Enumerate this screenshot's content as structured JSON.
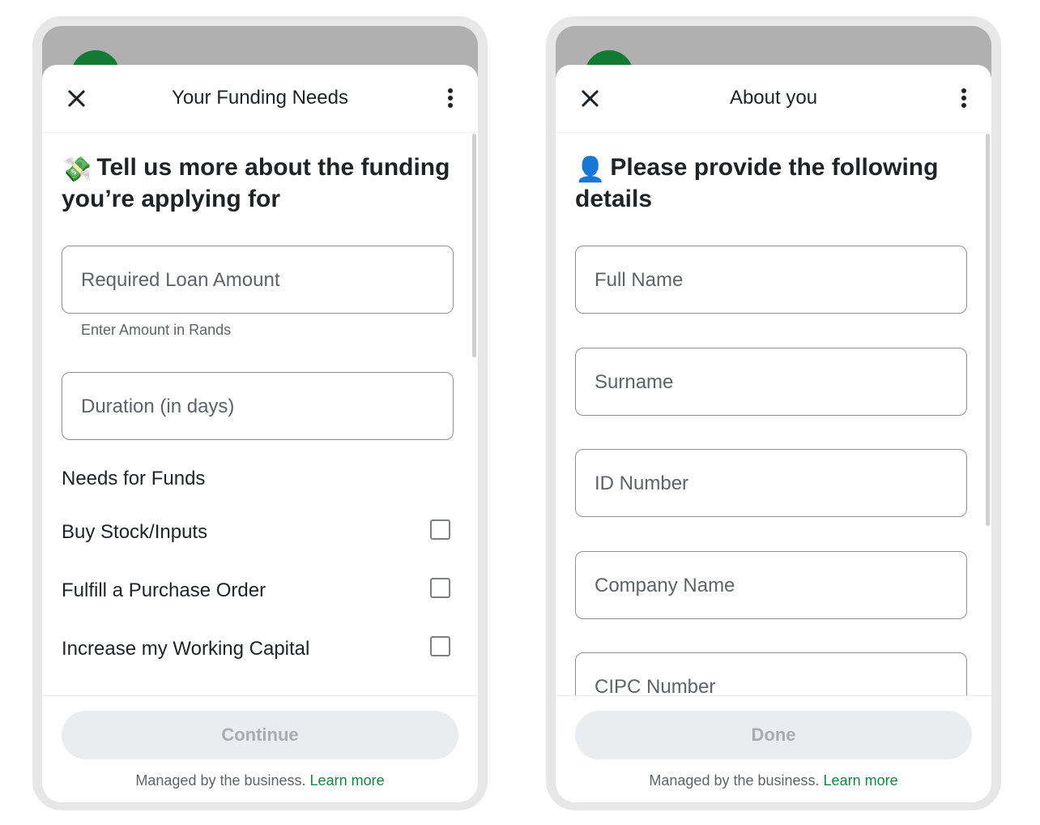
{
  "colors": {
    "accent_green": "#14853f",
    "avatar_green": "#127a33",
    "disabled_button_bg": "#e9edef",
    "disabled_button_text": "#a8adb2"
  },
  "screens": [
    {
      "title": "Your Funding Needs",
      "close_icon": "close-icon",
      "menu_icon": "more-vertical-icon",
      "heading_emoji": "💸",
      "heading": "Tell us more about the funding you’re applying for",
      "fields": [
        {
          "placeholder": "Required Loan Amount",
          "helper": "Enter Amount in Rands"
        },
        {
          "placeholder": "Duration (in days)"
        }
      ],
      "section_title": "Needs for Funds",
      "checkboxes": [
        {
          "label": "Buy Stock/Inputs",
          "checked": false
        },
        {
          "label": "Fulfill a Purchase Order",
          "checked": false
        },
        {
          "label": "Increase my Working Capital",
          "checked": false
        }
      ],
      "button": "Continue",
      "footer_text": "Managed by the business.",
      "footer_link": "Learn more"
    },
    {
      "title": "About you",
      "close_icon": "close-icon",
      "menu_icon": "more-vertical-icon",
      "heading_emoji": "👤",
      "heading": "Please provide the following details",
      "fields": [
        {
          "placeholder": "Full Name"
        },
        {
          "placeholder": "Surname"
        },
        {
          "placeholder": "ID Number"
        },
        {
          "placeholder": "Company Name"
        },
        {
          "placeholder": "CIPC Number"
        }
      ],
      "button": "Done",
      "footer_text": "Managed by the business.",
      "footer_link": "Learn more"
    }
  ]
}
